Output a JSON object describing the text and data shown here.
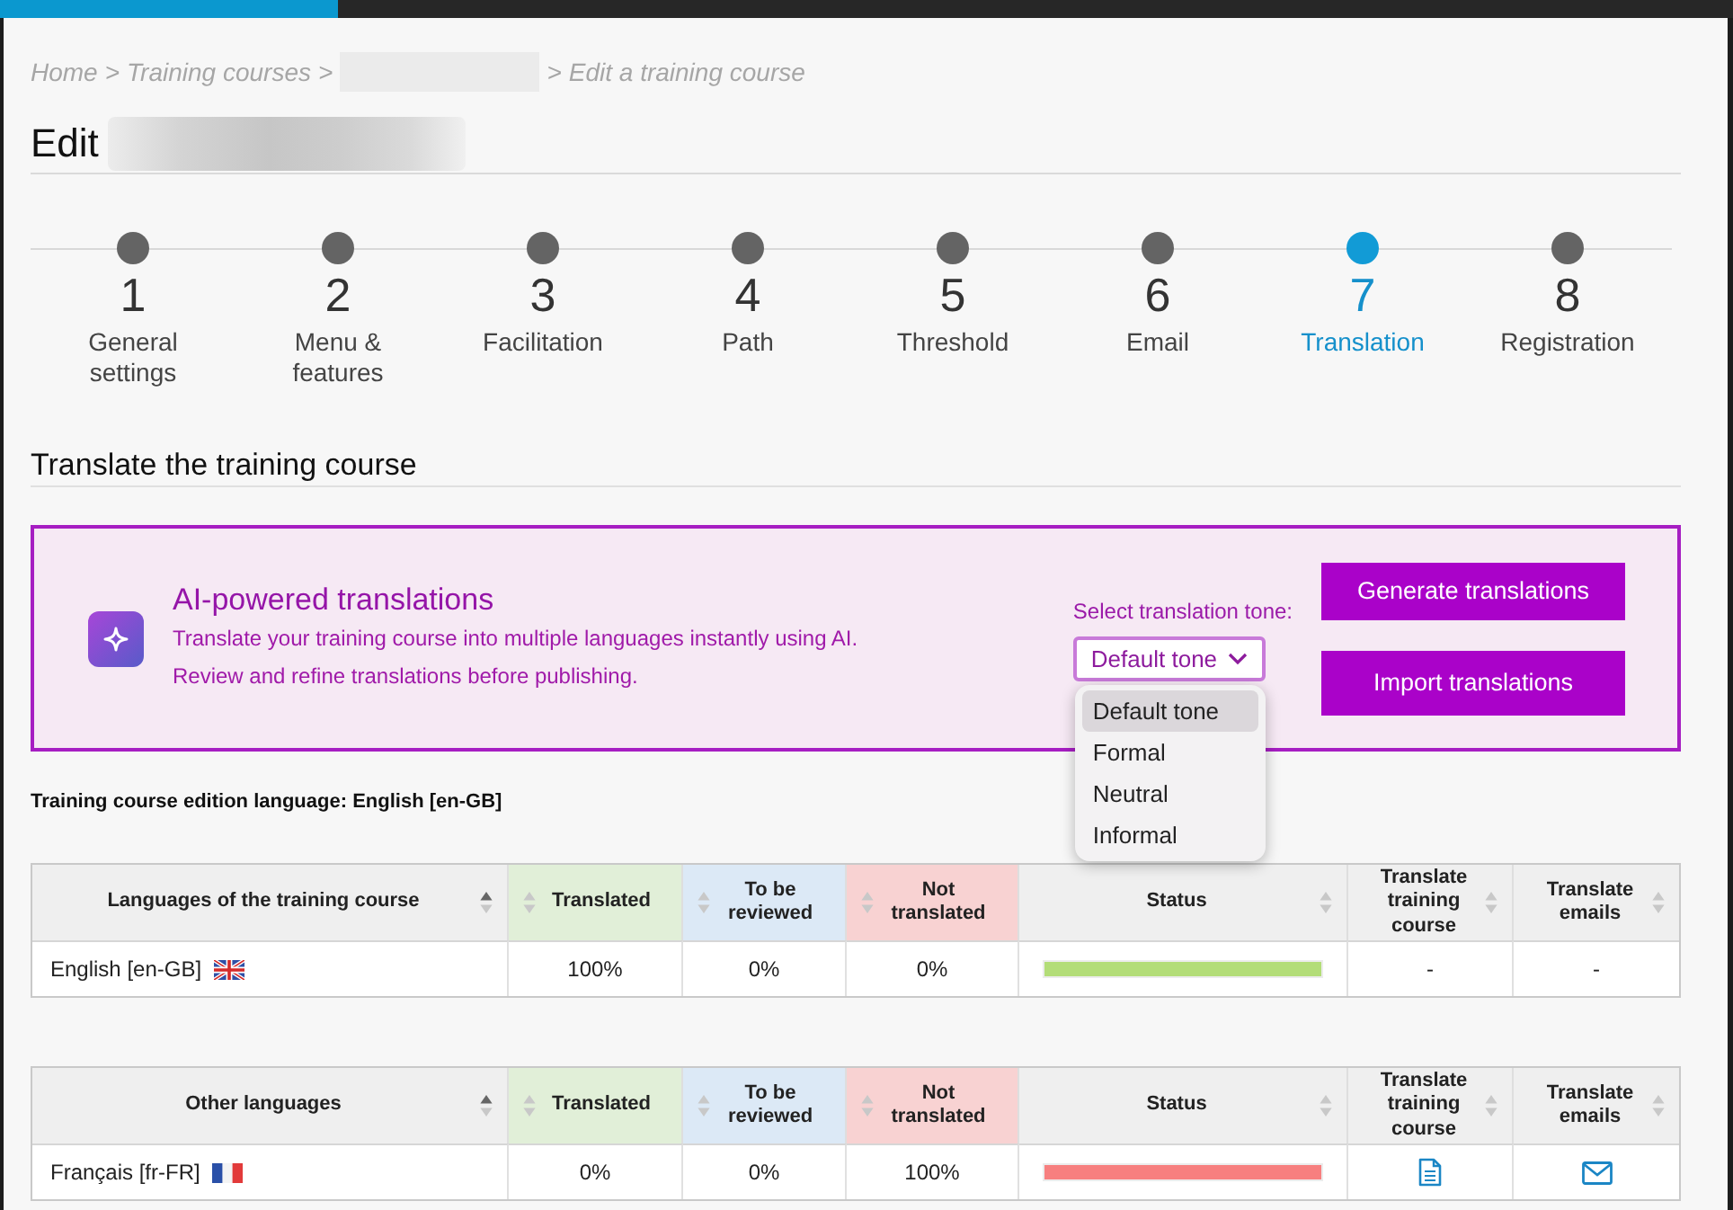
{
  "loading_bar": {
    "level": 0.195
  },
  "breadcrumb": [
    {
      "kind": "link",
      "label": "Home",
      "separator": ">"
    },
    {
      "kind": "link",
      "label": "Training courses",
      "separator": ">"
    },
    {
      "kind": "blurred",
      "separator": ">"
    },
    {
      "kind": "current",
      "label": "Edit a training course"
    }
  ],
  "page_title": {
    "text": "Edit",
    "blurred_name": true
  },
  "steps": [
    {
      "number": "1",
      "label": "General settings",
      "selected": false
    },
    {
      "number": "2",
      "label": "Menu & features",
      "selected": false
    },
    {
      "number": "3",
      "label": "Facilitation",
      "selected": false
    },
    {
      "number": "4",
      "label": "Path",
      "selected": false
    },
    {
      "number": "5",
      "label": "Threshold",
      "selected": false
    },
    {
      "number": "6",
      "label": "Email",
      "selected": false
    },
    {
      "number": "7",
      "label": "Translation",
      "selected": true
    },
    {
      "number": "8",
      "label": "Registration",
      "selected": false
    }
  ],
  "section_title": "Translate the training course",
  "ai_panel": {
    "title": "AI-powered translations",
    "description": [
      "Translate your training course into multiple languages instantly using AI.",
      "Review and refine translations before publishing."
    ],
    "tone": {
      "label": "Select translation tone:",
      "value": "Default tone",
      "expanded": true,
      "options": [
        {
          "label": "Default tone",
          "selected": true
        },
        {
          "label": "Formal",
          "selected": false
        },
        {
          "label": "Neutral",
          "selected": false
        },
        {
          "label": "Informal",
          "selected": false
        }
      ]
    },
    "buttons": [
      "Generate translations",
      "Import translations"
    ]
  },
  "edition_language": "Training course edition language: English [en-GB]",
  "tables": [
    {
      "columns": [
        {
          "label": "Languages of the training course",
          "kind": "language",
          "sorted": true
        },
        {
          "label": "Translated",
          "kind": "count",
          "color": "#e1efd8",
          "sorted": false
        },
        {
          "label": "To be reviewed",
          "kind": "count",
          "color": "#dce9f6",
          "sorted": false
        },
        {
          "label": "Not translated",
          "kind": "count",
          "color": "#f8d2d2",
          "sorted": false
        },
        {
          "label": "Status",
          "kind": "status",
          "sorted": false
        },
        {
          "label": "Translate training course",
          "kind": "course_action",
          "sorted": false
        },
        {
          "label": "Translate emails",
          "kind": "email_action",
          "sorted": false
        }
      ],
      "rows": [
        {
          "cells": [
            {
              "kind": "language",
              "text": "English [en-GB]",
              "flag": {
                "kind": "gb"
              }
            },
            {
              "kind": "text",
              "text": "100%"
            },
            {
              "kind": "text",
              "text": "0%"
            },
            {
              "kind": "text",
              "text": "0%"
            },
            {
              "kind": "bar",
              "color": "#b3dd78",
              "level": 1
            },
            {
              "kind": "text",
              "text": "-"
            },
            {
              "kind": "text",
              "text": "-"
            }
          ]
        }
      ]
    },
    {
      "columns": [
        {
          "label": "Other languages",
          "kind": "language",
          "sorted": true
        },
        {
          "label": "Translated",
          "kind": "count",
          "color": "#e1efd8",
          "sorted": false
        },
        {
          "label": "To be reviewed",
          "kind": "count",
          "color": "#dce9f6",
          "sorted": false
        },
        {
          "label": "Not translated",
          "kind": "count",
          "color": "#f8d2d2",
          "sorted": false
        },
        {
          "label": "Status",
          "kind": "status",
          "sorted": false
        },
        {
          "label": "Translate training course",
          "kind": "course_action",
          "sorted": false
        },
        {
          "label": "Translate emails",
          "kind": "email_action",
          "sorted": false
        }
      ],
      "rows": [
        {
          "cells": [
            {
              "kind": "language",
              "text": "Français [fr-FR]",
              "flag": {
                "kind": "fr"
              }
            },
            {
              "kind": "text",
              "text": "0%"
            },
            {
              "kind": "text",
              "text": "0%"
            },
            {
              "kind": "text",
              "text": "100%"
            },
            {
              "kind": "bar",
              "color": "#f77f7f",
              "level": 1
            },
            {
              "kind": "link"
            },
            {
              "kind": "link"
            }
          ]
        }
      ]
    }
  ]
}
